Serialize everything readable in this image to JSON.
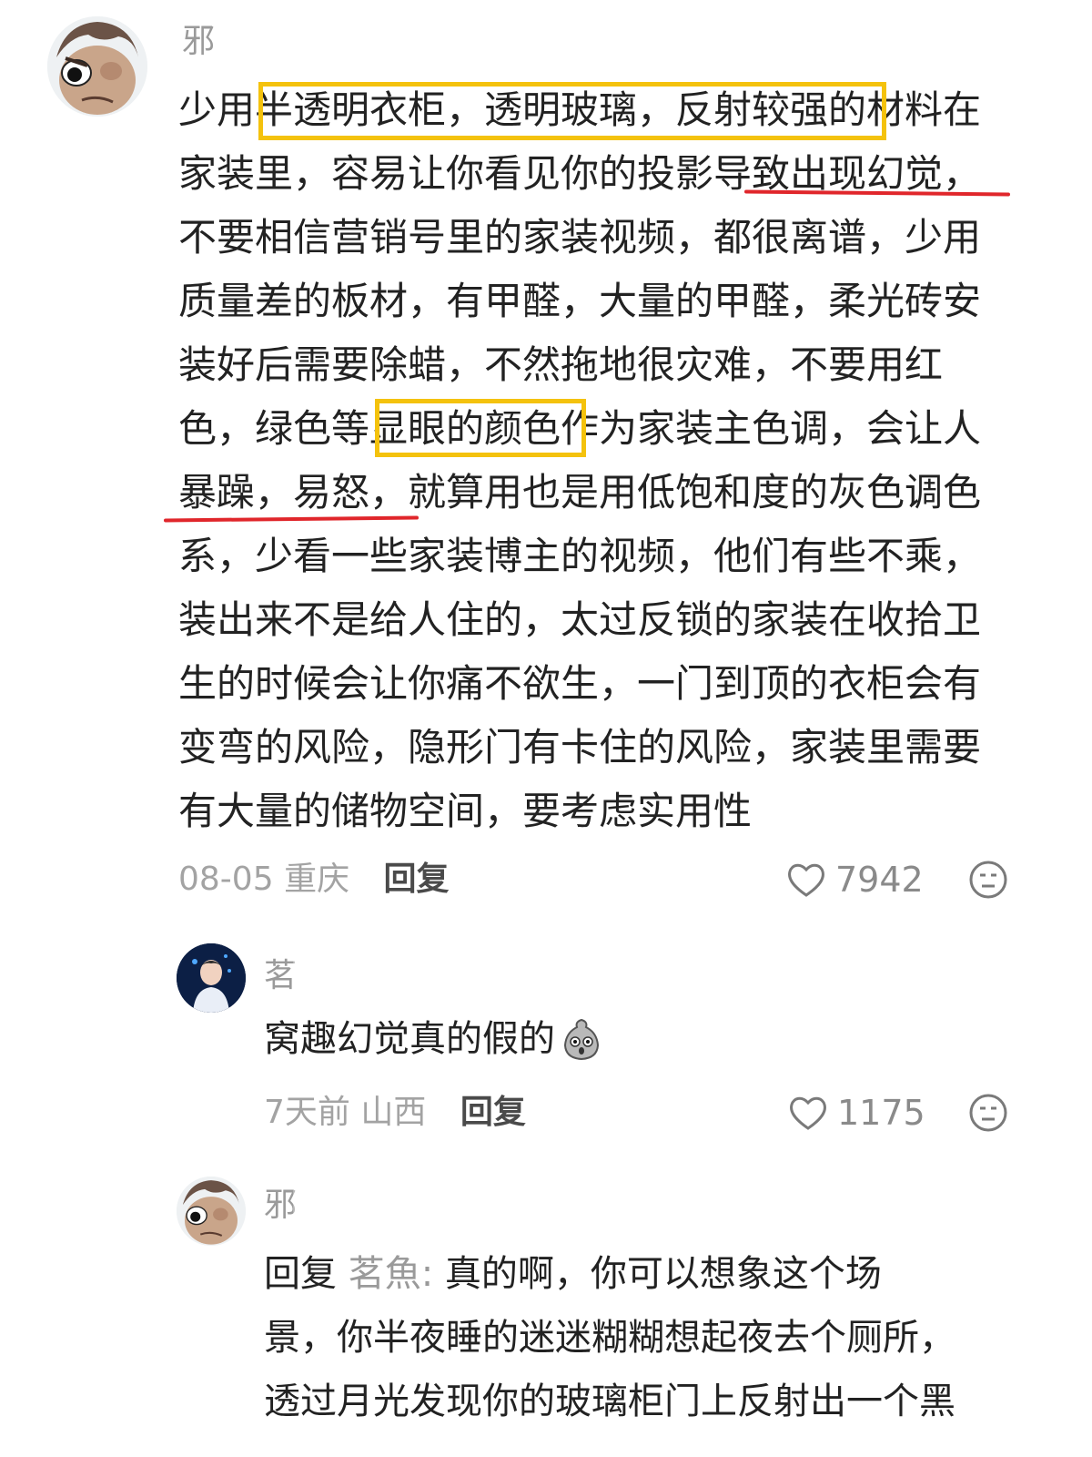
{
  "main_comment": {
    "username": "邪",
    "lines": [
      "少用半透明衣柜，透明玻璃，反射较强的材料在",
      "家装里，容易让你看见你的投影导致出现幻觉，",
      "不要相信营销号里的家装视频，都很离谱，少用",
      "质量差的板材，有甲醛，大量的甲醛，柔光砖安",
      "装好后需要除蜡，不然拖地很灾难，不要用红",
      "色，绿色等显眼的颜色作为家装主色调，会让人",
      "暴躁，易怒，就算用也是用低饱和度的灰色调色",
      "系，少看一些家装博主的视频，他们有些不乘，",
      "装出来不是给人住的，太过反锁的家装在收拾卫",
      "生的时候会让你痛不欲生，一门到顶的衣柜会有",
      "变弯的风险，隐形门有卡住的风险，家装里需要",
      "有大量的储物空间，要考虑实用性"
    ],
    "date": "08-05",
    "location": "重庆",
    "reply_label": "回复",
    "likes": "7942"
  },
  "reply_1": {
    "username": "茗",
    "text": "窝趣幻觉真的假的",
    "date": "7天前",
    "location": "山西",
    "reply_label": "回复",
    "likes": "1175"
  },
  "reply_2": {
    "username": "邪",
    "reply_prefix": "回复",
    "mention": "茗魚:",
    "lines": [
      "真的啊，你可以想象这个场",
      "景，你半夜睡的迷迷糊糊想起夜去个厕所，",
      "透过月光发现你的玻璃柜门上反射出一个黑"
    ]
  },
  "colors": {
    "highlight_box": "#f4c20d",
    "underline": "#e0262b",
    "meta_text": "#a3a3a3"
  },
  "icons": [
    "heart-icon",
    "dislike-face-icon",
    "emoji-icon"
  ]
}
